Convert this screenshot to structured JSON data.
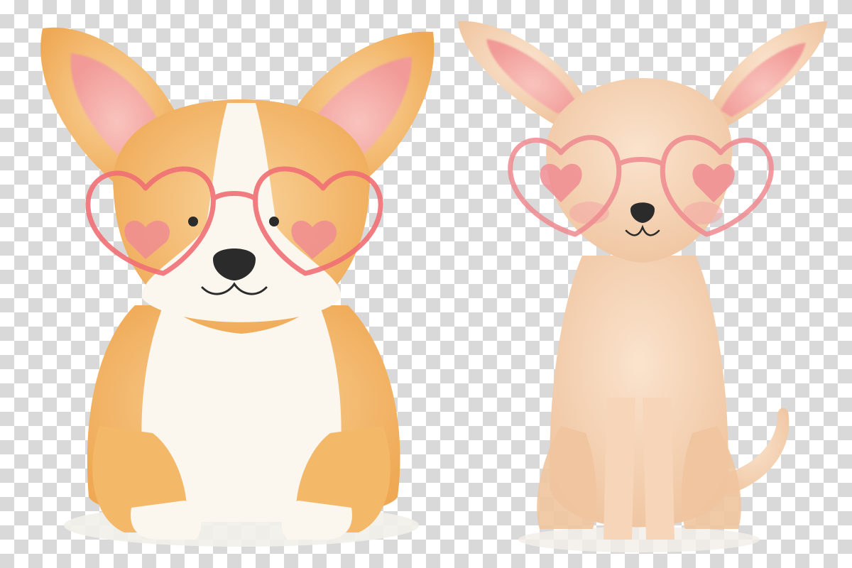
{
  "scene": {
    "background": "transparency-checkerboard",
    "subjects": [
      "corgi",
      "chihuahua"
    ]
  },
  "colors": {
    "checker_light": "#ffffff",
    "checker_dark": "#d9d9d9",
    "corgi_fur": "#f3b868",
    "corgi_fur_light": "#f7cd8e",
    "corgi_white": "#fbf6ee",
    "chihuahua_fur": "#f6d5b8",
    "chihuahua_fur_shade": "#eebf98",
    "inner_ear": "#f6a9a4",
    "glasses_frame": "#ef6f74",
    "heart_blush": "#f08c92",
    "nose": "#2b2b2b"
  },
  "icons": {
    "corgi": "corgi-illustration",
    "chihuahua": "chihuahua-illustration",
    "glasses": "heart-glasses-icon"
  }
}
